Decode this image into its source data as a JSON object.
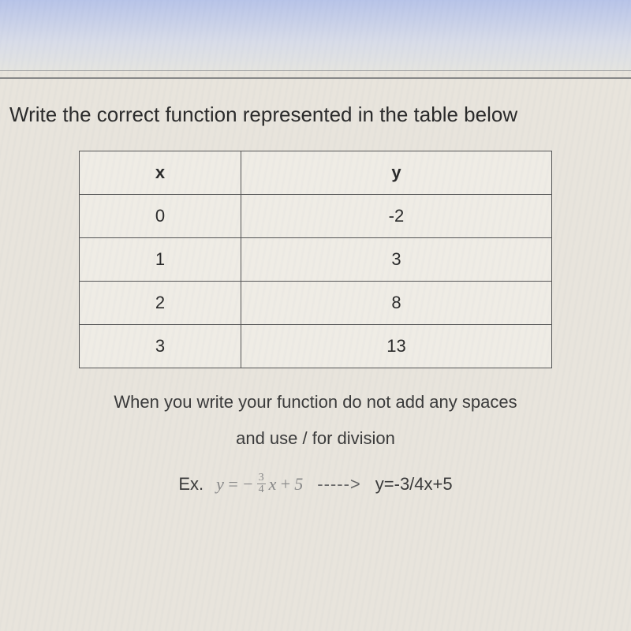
{
  "question": {
    "title": "Write the correct function represented in the table below",
    "table": {
      "headers": {
        "col1": "x",
        "col2": "y"
      },
      "rows": [
        {
          "x": "0",
          "y": "-2"
        },
        {
          "x": "1",
          "y": "3"
        },
        {
          "x": "2",
          "y": "8"
        },
        {
          "x": "3",
          "y": "13"
        }
      ]
    },
    "instruction_line1": "When you write your function do not add any spaces",
    "instruction_line2": "and use / for division",
    "example": {
      "prefix": "Ex.",
      "math_y": "y",
      "math_eq": "=",
      "math_neg": "−",
      "frac_num": "3",
      "frac_den": "4",
      "math_x": "x",
      "math_plus": "+",
      "math_five": "5",
      "arrow": "----->",
      "plain": "y=-3/4x+5"
    }
  }
}
